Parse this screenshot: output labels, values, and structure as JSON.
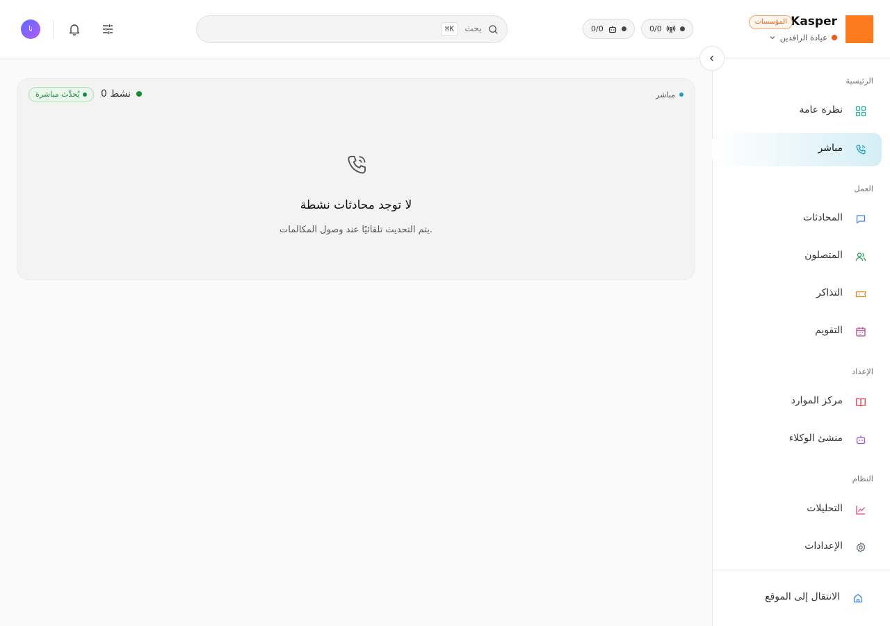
{
  "brand": {
    "name": "Kasper",
    "badge": "المؤسسات",
    "org": "عيادة الرافدين",
    "accent": "#fb7a1d"
  },
  "header": {
    "status_pills": [
      {
        "icon": "antenna-icon",
        "value": "0/0"
      },
      {
        "icon": "bot-icon",
        "value": "0/0"
      }
    ],
    "search": {
      "placeholder": "بحث",
      "shortcut": "⌘K"
    },
    "avatar_initials": "نا"
  },
  "sidebar": {
    "sections": [
      {
        "title": "الرئيسية",
        "items": [
          {
            "label": "نظرة عامة",
            "icon": "grid-icon",
            "color": "#1bb38f"
          },
          {
            "label": "مباشر",
            "icon": "phone-call-icon",
            "color": "#1a9ec4",
            "active": true
          }
        ]
      },
      {
        "title": "العمل",
        "items": [
          {
            "label": "المحادثات",
            "icon": "message-icon",
            "color": "#3b82f6"
          },
          {
            "label": "المتصلون",
            "icon": "users-icon",
            "color": "#22a05a"
          },
          {
            "label": "التذاكر",
            "icon": "ticket-icon",
            "color": "#e08a1b"
          },
          {
            "label": "التقويم",
            "icon": "calendar-icon",
            "color": "#b0468c"
          }
        ]
      },
      {
        "title": "الإعداد",
        "items": [
          {
            "label": "مركز الموارد",
            "icon": "book-icon",
            "color": "#e0394a"
          },
          {
            "label": "منشئ الوكلاء",
            "icon": "bot-icon",
            "color": "#9b4ee0"
          }
        ]
      },
      {
        "title": "النظام",
        "items": [
          {
            "label": "التحليلات",
            "icon": "chart-icon",
            "color": "#e2457a"
          },
          {
            "label": "الإعدادات",
            "icon": "gear-icon",
            "color": "#6b7280"
          }
        ]
      }
    ],
    "footer": {
      "label": "الانتقال إلى الموقع",
      "icon": "home-icon",
      "color": "#3b82f6"
    }
  },
  "live_panel": {
    "label": "مباشر",
    "active_count": "0 نشط",
    "update_badge": "يُحدَّث مباشرة",
    "empty_title": "لا توجد محادثات نشطة",
    "empty_subtitle": "يتم التحديث تلقائيًا عند وصول المكالمات."
  }
}
